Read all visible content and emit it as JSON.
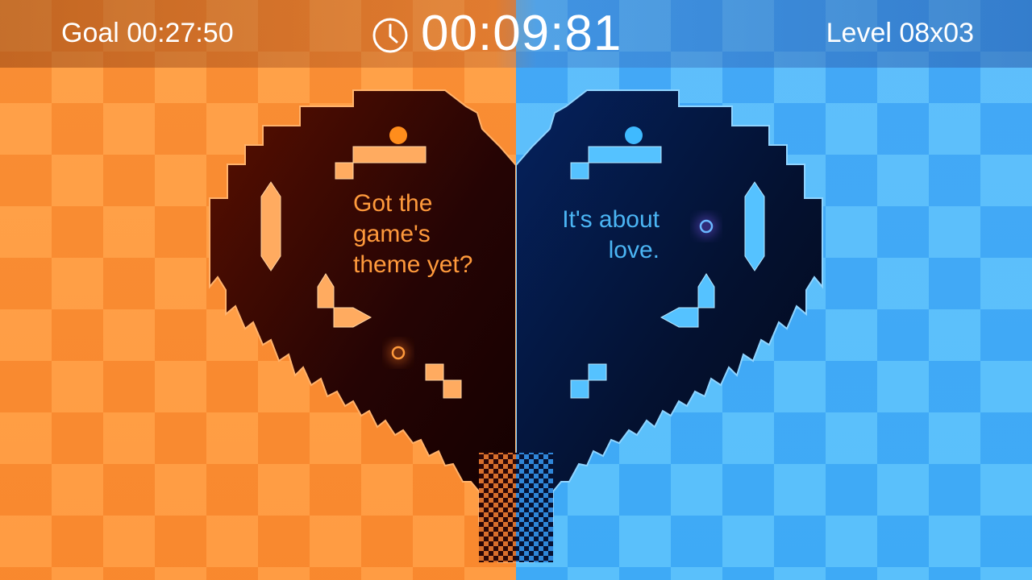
{
  "hud": {
    "goal_label": "Goal 00:27:50",
    "timer": "00:09:81",
    "level_label": "Level 08x03"
  },
  "dialogue": {
    "left": [
      "Got the",
      "game's",
      "theme yet?"
    ],
    "right": [
      "It's about",
      "love."
    ]
  },
  "colors": {
    "left_theme": "#ff9a3c",
    "right_theme": "#4bb5f4",
    "hud_text": "#ffffff"
  },
  "icons": {
    "timer": "clock-icon",
    "left_pickup": "ring-orb-icon",
    "right_pickup": "ring-orb-icon"
  }
}
